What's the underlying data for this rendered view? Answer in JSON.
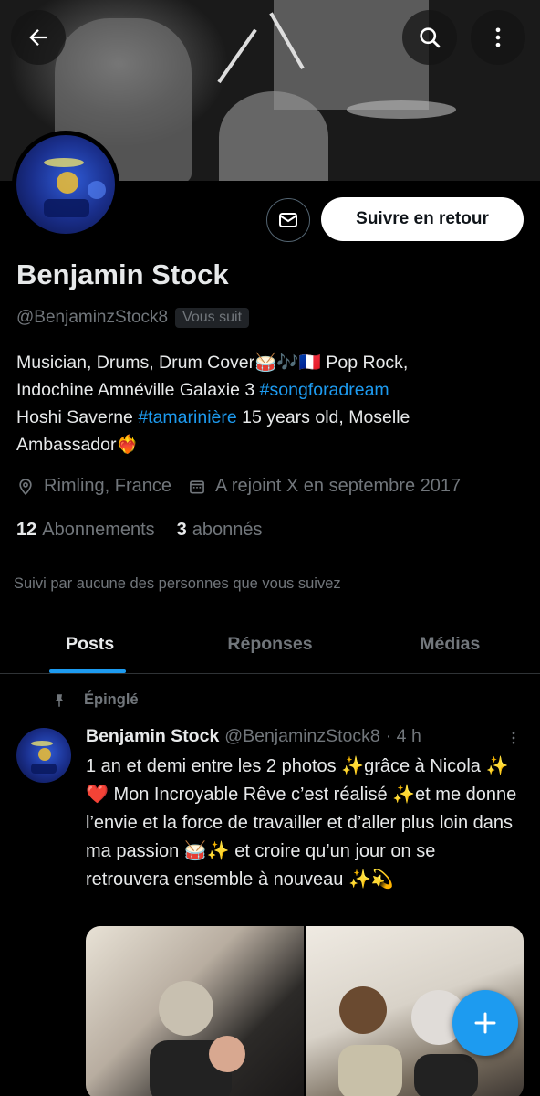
{
  "profile": {
    "name": "Benjamin Stock",
    "handle": "@BenjaminzStock8",
    "follows_you_badge": "Vous suit",
    "follow_button": "Suivre en retour",
    "bio_line1": "Musician, Drums, Drum Cover🥁🎶🇫🇷  Pop Rock,",
    "bio_line2_a": "Indochine Amnéville Galaxie  3 ",
    "bio_line2_link": "#songforadream",
    "bio_line3_a": "Hoshi Saverne  ",
    "bio_line3_link": "#tamarinière",
    "bio_line3_b": "  15 years old, Moselle",
    "bio_line4": "Ambassador❤️‍🔥",
    "location": "Rimling, France",
    "joined": "A rejoint X en septembre 2017",
    "following_count": "12",
    "following_label": "Abonnements",
    "followers_count": "3",
    "followers_label": "abonnés",
    "followed_by_text": "Suivi par aucune des personnes que vous suivez"
  },
  "tabs": [
    {
      "label": "Posts"
    },
    {
      "label": "Réponses"
    },
    {
      "label": "Médias"
    }
  ],
  "pinned_post": {
    "pinned_label": "Épinglé",
    "author_name": "Benjamin Stock",
    "author_handle": "@BenjaminzStock8",
    "time": "· 4 h",
    "text": "1 an et demi entre les 2 photos ✨grâce à Nicola ✨❤️ Mon Incroyable Rêve c’est réalisé ✨et me donne l’envie et la force de travailler et d’aller plus loin dans ma passion 🥁✨ et croire qu’un jour on se retrouvera ensemble à nouveau ✨💫"
  },
  "icons": {
    "back": "arrow-left-icon",
    "search": "search-icon",
    "more": "more-vertical-icon",
    "message": "envelope-icon",
    "location": "location-pin-icon",
    "calendar": "calendar-icon",
    "pin": "pin-icon",
    "compose": "plus-icon"
  },
  "colors": {
    "accent": "#1d9bf0",
    "background": "#000000",
    "secondary_text": "#71767b"
  }
}
